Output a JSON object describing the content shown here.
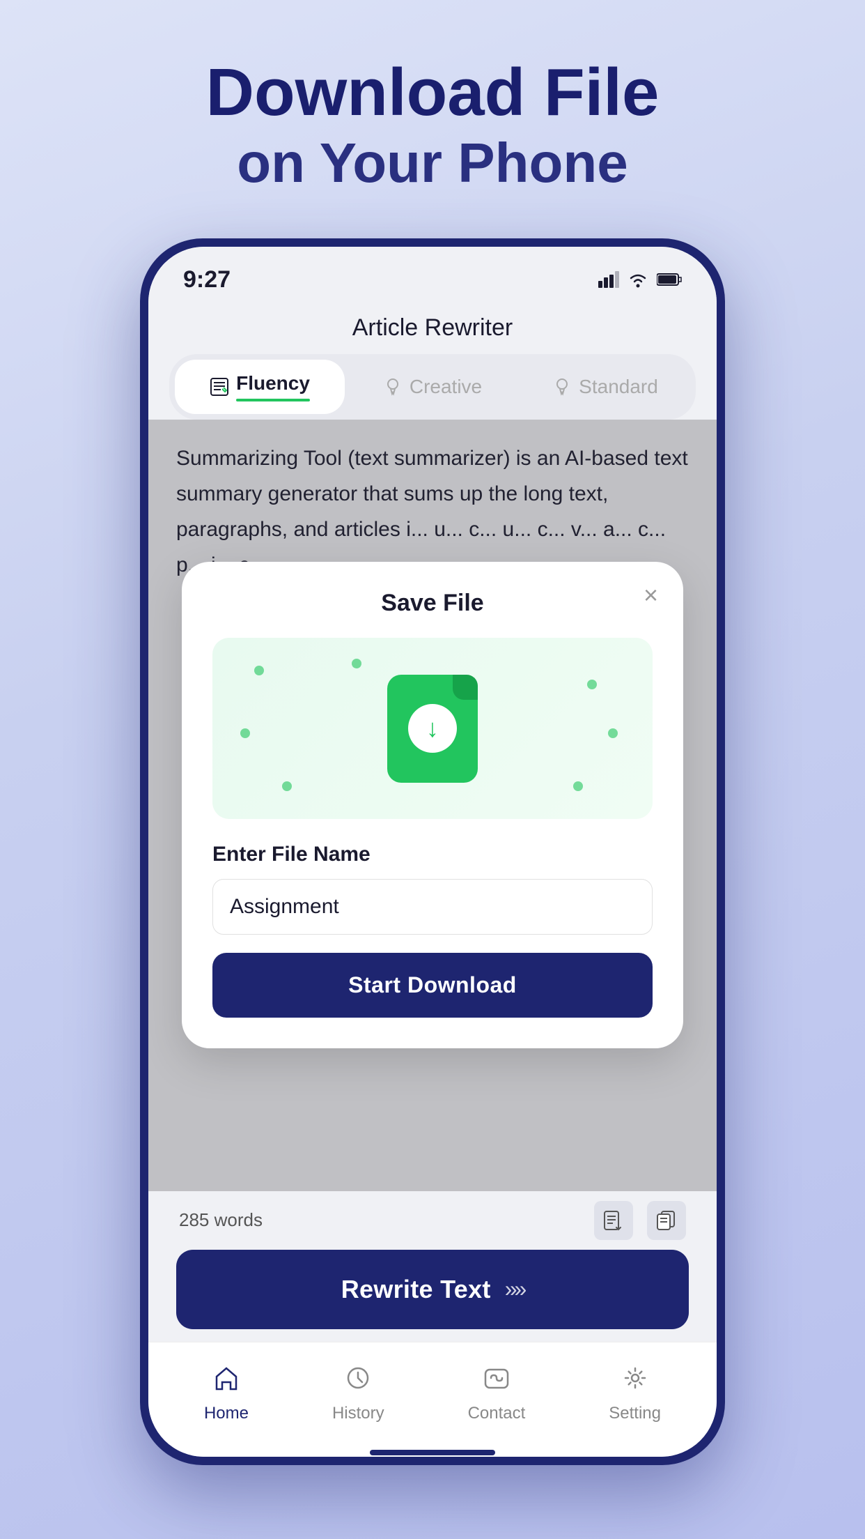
{
  "header": {
    "title_main": "Download File",
    "title_sub": "on Your Phone"
  },
  "status_bar": {
    "time": "9:27"
  },
  "app": {
    "title": "Article Rewriter"
  },
  "tabs": [
    {
      "id": "fluency",
      "label": "Fluency",
      "active": true
    },
    {
      "id": "creative",
      "label": "Creative",
      "active": false
    },
    {
      "id": "standard",
      "label": "Standard",
      "active": false
    }
  ],
  "article": {
    "text": "Summarizing Tool (text summarizer) is an AI-based text summary generator that sums up the long text, paragraphs, and articles i... u... c... u... c... v... a... c... p... i... c..."
  },
  "modal": {
    "title": "Save File",
    "field_label": "Enter File Name",
    "file_name_value": "Assignment",
    "file_name_placeholder": "Assignment",
    "download_button": "Start Download",
    "close_label": "×"
  },
  "bottom": {
    "words_count": "285 words",
    "rewrite_button": "Rewrite Text"
  },
  "nav": [
    {
      "id": "home",
      "label": "Home",
      "active": true
    },
    {
      "id": "history",
      "label": "History",
      "active": false
    },
    {
      "id": "contact",
      "label": "Contact",
      "active": false
    },
    {
      "id": "setting",
      "label": "Setting",
      "active": false
    }
  ]
}
